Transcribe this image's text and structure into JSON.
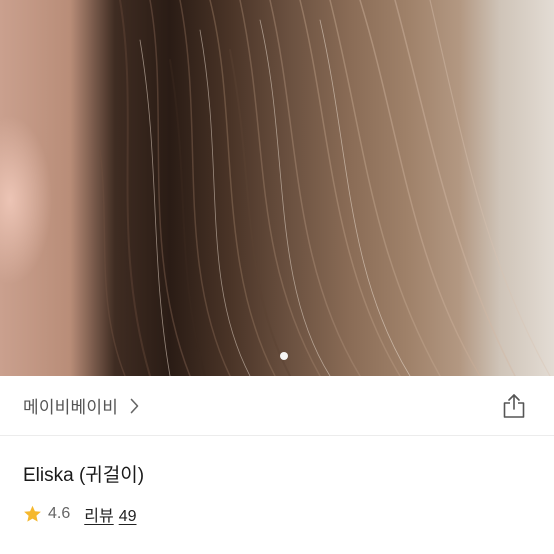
{
  "product": {
    "brand": "메이비베이비",
    "title": "Eliska (귀걸이)",
    "rating": "4.6",
    "review_label": "리뷰",
    "review_count": "49"
  },
  "carousel": {
    "image_subject": "hair close-up photo",
    "pages": 1,
    "current_page": 1
  },
  "icons": {
    "brand_arrow": "chevron-right-icon",
    "share": "share-icon",
    "rating": "star-icon"
  },
  "colors": {
    "star": "#f5b82e",
    "text_primary": "#1a1a1a",
    "text_secondary": "#666666",
    "divider": "#ececec"
  }
}
